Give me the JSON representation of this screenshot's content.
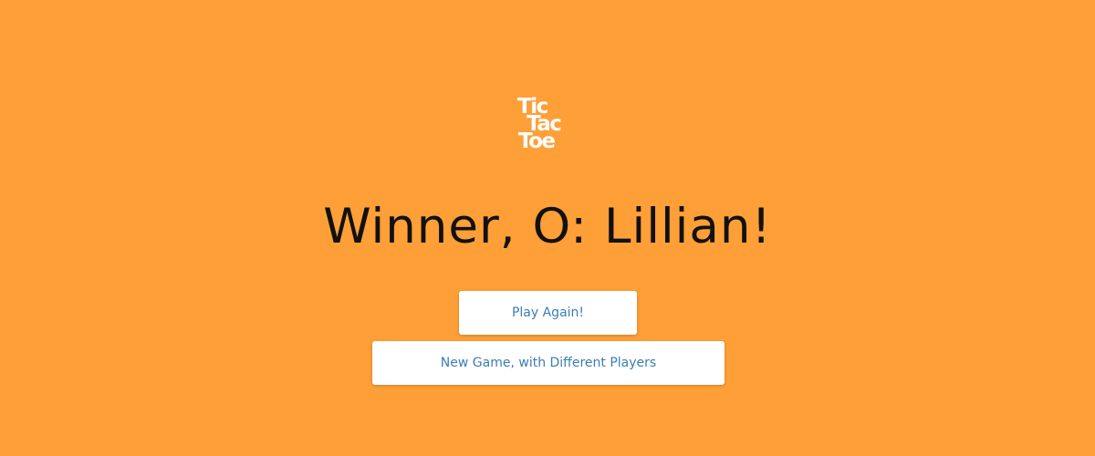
{
  "theme": {
    "background": "#FF9F37",
    "logo_color": "#FFFFFF",
    "winner_text_color": "#111111",
    "button_bg": "#FFFFFF",
    "button_text_color": "#3A7DB5"
  },
  "logo": {
    "lines": [
      "Tic",
      "Tac",
      "Toe"
    ]
  },
  "result": {
    "winner_text": "Winner, O: Lillian!"
  },
  "actions": {
    "play_again_label": "Play Again!",
    "new_game_label": "New Game, with Different Players"
  }
}
